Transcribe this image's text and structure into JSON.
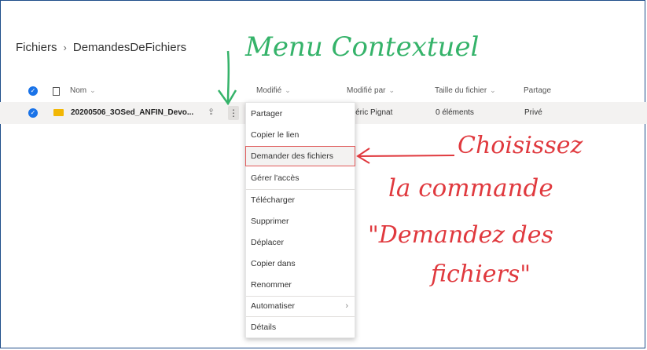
{
  "breadcrumb": {
    "root": "Fichiers",
    "separator": "›",
    "current": "DemandesDeFichiers"
  },
  "columns": {
    "name": "Nom",
    "modified": "Modifié",
    "modified_by": "Modifié par",
    "size": "Taille du fichier",
    "sharing": "Partage"
  },
  "row": {
    "name": "20200506_3OSed_ANFIN_Devo...",
    "modified_by": "édéric Pignat",
    "size": "0 éléments",
    "sharing": "Privé"
  },
  "menu": {
    "items": [
      "Partager",
      "Copier le lien",
      "Demander des fichiers",
      "Gérer l'accès",
      "Télécharger",
      "Supprimer",
      "Déplacer",
      "Copier dans",
      "Renommer",
      "Automatiser",
      "Détails"
    ]
  },
  "annotations": {
    "menu_label": "Menu Contextuel",
    "instruction": [
      "Choisissez",
      "la commande",
      "\"Demandez des",
      "fichiers\""
    ]
  },
  "colors": {
    "accent": "#1a73e8",
    "annotation_green": "#35b36a",
    "annotation_red": "#e0393e",
    "folder": "#f2b705"
  }
}
